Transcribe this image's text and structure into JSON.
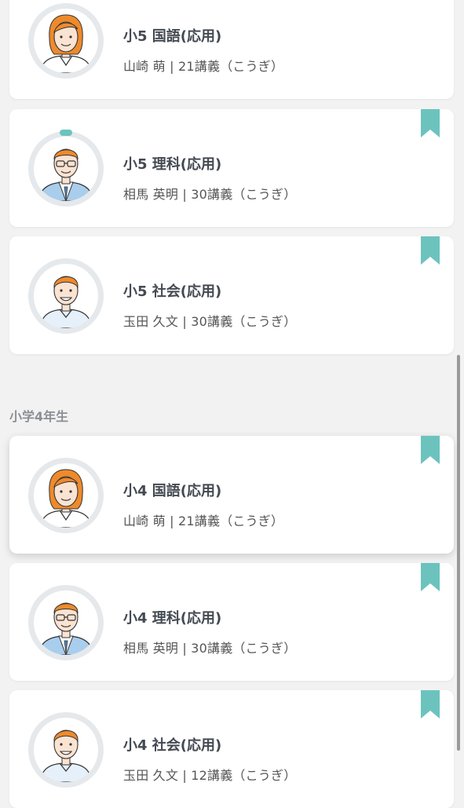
{
  "sections": [
    {
      "title": "小学4年生"
    }
  ],
  "courses": [
    {
      "title": "小5 国語(応用)",
      "meta": "山崎 萌 | 21講義（こうぎ）",
      "instructor_icon": "female-teacher-avatar"
    },
    {
      "title": "小5 理科(応用)",
      "meta": "相馬 英明 | 30講義（こうぎ）",
      "instructor_icon": "glasses-teacher-avatar"
    },
    {
      "title": "小5 社会(応用)",
      "meta": "玉田 久文 | 30講義（こうぎ）",
      "instructor_icon": "male-teacher-avatar"
    },
    {
      "title": "小4 国語(応用)",
      "meta": "山崎 萌 | 21講義（こうぎ）",
      "instructor_icon": "female-teacher-avatar"
    },
    {
      "title": "小4 理科(応用)",
      "meta": "相馬 英明 | 30講義（こうぎ）",
      "instructor_icon": "glasses-teacher-avatar"
    },
    {
      "title": "小4 社会(応用)",
      "meta": "玉田 久文 | 12講義（こうぎ）",
      "instructor_icon": "male-teacher-avatar"
    }
  ],
  "colors": {
    "background": "#f2f2f2",
    "card": "#ffffff",
    "bookmark": "#6cc3be",
    "avatar_ring": "#e5e9ec",
    "title_text": "#444a52",
    "section_text": "#8b9096"
  },
  "icons": {
    "bookmark": "bookmark-icon"
  }
}
